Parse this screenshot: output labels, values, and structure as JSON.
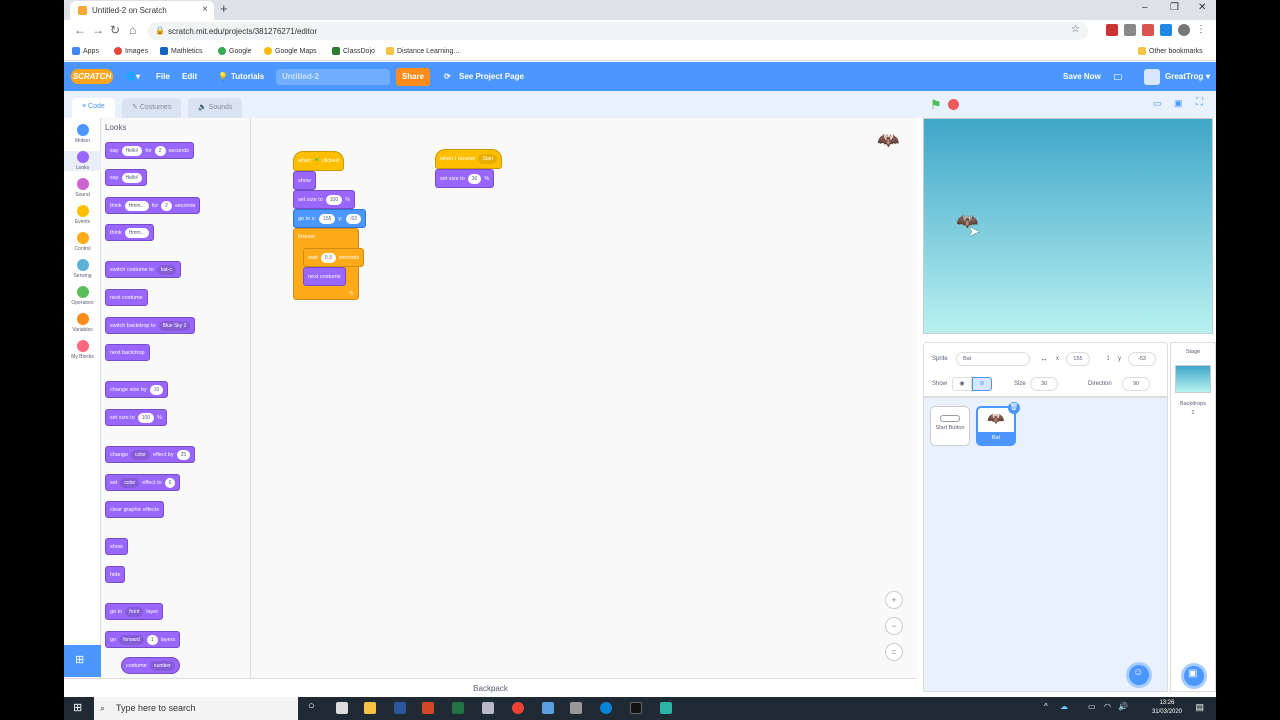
{
  "browser": {
    "tab_title": "Untitled-2 on Scratch",
    "new_tab_icon": "plus-icon",
    "url": "scratch.mit.edu/projects/381276271/editor",
    "bookmarks": [
      "Apps",
      "Images",
      "Mathletics",
      "Google",
      "Google Maps",
      "ClassDojo",
      "Distance Learning...",
      "Other bookmarks"
    ]
  },
  "menubar": {
    "logo": "SCRATCH",
    "file": "File",
    "edit": "Edit",
    "tutorials": "Tutorials",
    "project_title": "Untitled-2",
    "share": "Share",
    "see_project": "See Project Page",
    "save_now": "Save Now",
    "username": "GreatTrog"
  },
  "editor_tabs": {
    "code": "Code",
    "costumes": "Costumes",
    "sounds": "Sounds"
  },
  "categories": [
    {
      "label": "Motion",
      "color": "#4c97ff"
    },
    {
      "label": "Looks",
      "color": "#9966ff"
    },
    {
      "label": "Sound",
      "color": "#cf63cf"
    },
    {
      "label": "Events",
      "color": "#ffbf00"
    },
    {
      "label": "Control",
      "color": "#ffab19"
    },
    {
      "label": "Sensing",
      "color": "#5cb1d6"
    },
    {
      "label": "Operators",
      "color": "#59c059"
    },
    {
      "label": "Variables",
      "color": "#ff8c1a"
    },
    {
      "label": "My Blocks",
      "color": "#ff6680"
    }
  ],
  "palette": {
    "heading": "Looks",
    "say_for": {
      "say": "say",
      "msg": "Hello!",
      "for": "for",
      "secs": "2",
      "seconds": "seconds"
    },
    "say": {
      "say": "say",
      "msg": "Hello!"
    },
    "think_for": {
      "think": "think",
      "msg": "Hmm...",
      "for": "for",
      "secs": "2",
      "seconds": "seconds"
    },
    "think": {
      "think": "think",
      "msg": "Hmm..."
    },
    "switch_costume": {
      "label": "switch costume to",
      "value": "bat-c"
    },
    "next_costume": "next costume",
    "switch_backdrop": {
      "label": "switch backdrop to",
      "value": "Blue Sky 2"
    },
    "next_backdrop": "next backdrop",
    "change_size": {
      "label": "change size by",
      "value": "10"
    },
    "set_size": {
      "label": "set size to",
      "value": "100",
      "unit": "%"
    },
    "change_effect": {
      "change": "change",
      "effect": "color",
      "by": "effect by",
      "value": "25"
    },
    "set_effect": {
      "set": "set",
      "effect": "color",
      "to": "effect to",
      "value": "0"
    },
    "clear_effects": "clear graphic effects",
    "show": "show",
    "hide": "hide",
    "go_to_layer": {
      "go": "go to",
      "value": "front",
      "layer": "layer"
    },
    "go_layers": {
      "go": "go",
      "dir": "forward",
      "value": "1",
      "layers": "layers"
    },
    "costume_reporter": {
      "label": "costume",
      "value": "number"
    }
  },
  "script1": {
    "hat": {
      "when": "when",
      "clicked": "clicked"
    },
    "show": "show",
    "set_size": {
      "label": "set size to",
      "value": "100",
      "unit": "%"
    },
    "goto": {
      "label": "go to x:",
      "x": "155",
      "y_label": "y:",
      "y": "-53"
    },
    "forever": "forever",
    "wait": {
      "label": "wait",
      "value": "0.3",
      "unit": "seconds"
    },
    "next_costume": "next costume"
  },
  "script2": {
    "hat": {
      "label": "when I receive",
      "value": "Start"
    },
    "set_size": {
      "label": "set size to",
      "value": "30",
      "unit": "%"
    }
  },
  "sprite_info": {
    "sprite_label": "Sprite",
    "sprite_name": "Bat",
    "x_label": "x",
    "x": "155",
    "y_label": "y",
    "y": "-53",
    "show_label": "Show",
    "size_label": "Size",
    "size": "30",
    "direction_label": "Direction",
    "direction": "90"
  },
  "sprites": [
    {
      "name": "Start Button",
      "selected": false
    },
    {
      "name": "Bat",
      "selected": true
    }
  ],
  "stage_pane": {
    "title": "Stage",
    "backdrops_label": "Backdrops",
    "backdrops_count": "2"
  },
  "backpack": "Backpack",
  "taskbar": {
    "search_placeholder": "Type here to search",
    "time": "13:26",
    "date": "31/03/2020"
  }
}
